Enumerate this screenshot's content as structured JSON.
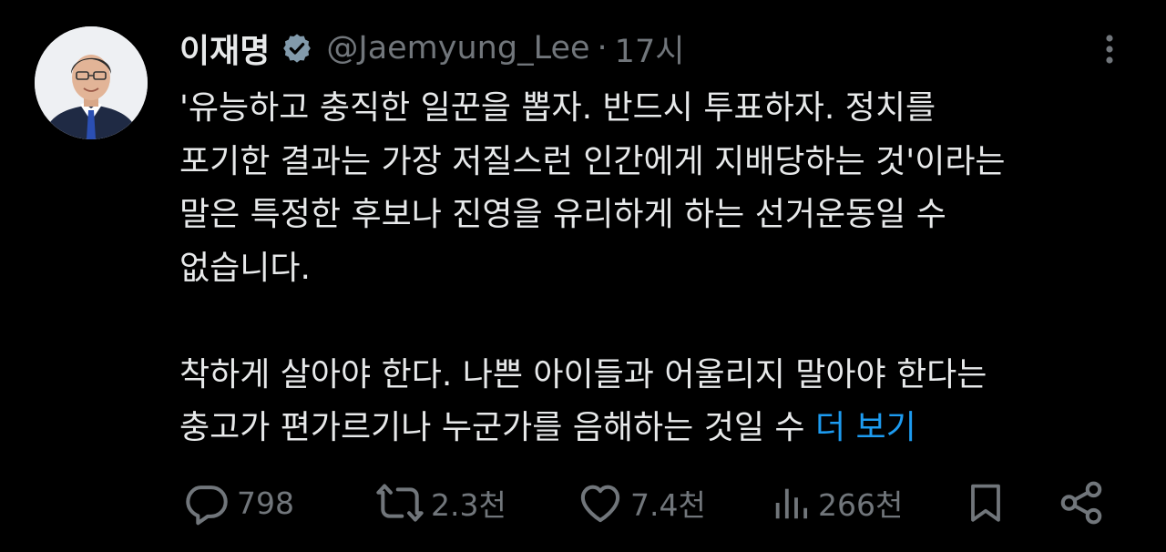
{
  "tweet": {
    "author_name": "이재명",
    "handle": "@Jaemyung_Lee",
    "separator": "·",
    "time": "17시",
    "paragraph1": [
      "'유능하고 충직한 일꾼을 뽑자. 반드시 투표하자. 정치를",
      "포기한 결과는 가장 저질스런 인간에게 지배당하는 것'이라는",
      "말은 특정한 후보나 진영을 유리하게 하는 선거운동일 수",
      "없습니다."
    ],
    "paragraph2": [
      "착하게 살아야 한다. 나쁜 아이들과 어울리지 말아야 한다는",
      "충고가 편가르기나 누군가를 음해하는 것일 수"
    ],
    "show_more": "더 보기"
  },
  "actions": {
    "reply_count": "798",
    "retweet_count": "2.3천",
    "like_count": "7.4천",
    "views_count": "266천"
  },
  "icons": {
    "verified": "verified-badge-icon",
    "more": "more-options-icon",
    "reply": "reply-icon",
    "retweet": "retweet-icon",
    "like": "heart-icon",
    "views": "views-icon",
    "bookmark": "bookmark-icon",
    "share": "share-icon"
  },
  "colors": {
    "background": "#000000",
    "text": "#e7e9ea",
    "secondary": "#71767b",
    "link": "#1d9bf0",
    "suit": "#1f2a44",
    "tie": "#2b4fb3"
  }
}
